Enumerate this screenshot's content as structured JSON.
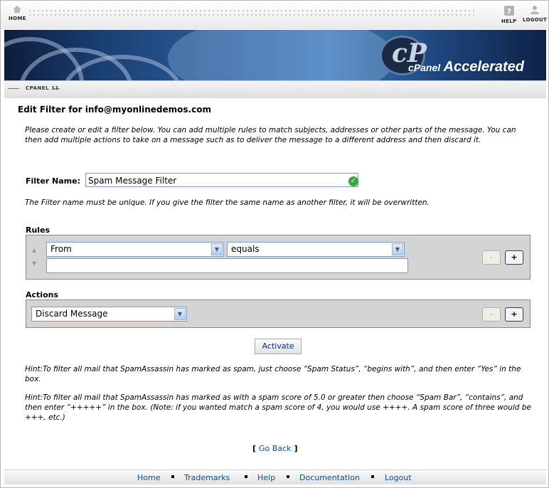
{
  "topbar": {
    "home_label": "HOME",
    "help_label": "HELP",
    "logout_label": "LOGOUT"
  },
  "banner": {
    "logo_cp": "cP",
    "logo_brand": "cPanel",
    "logo_suffix": "Accelerated"
  },
  "subbar": {
    "label": "CPANEL 11"
  },
  "page": {
    "title": "Edit Filter for info@myonlinedemos.com",
    "intro": "Please create or edit a filter below. You can add multiple rules to match subjects, addresses or other parts of the message. You can then add multiple actions to take on a message such as to deliver the message to a different address and then discard it.",
    "filter_name_label": "Filter Name:",
    "filter_name_value": "Spam Message Filter",
    "unique_note": "The Filter name must be unique. If you give the filter the same name as another filter, it will be overwritten."
  },
  "rules": {
    "label": "Rules",
    "part_value": "From",
    "match_value": "equals",
    "text_value": "",
    "minus_label": "-",
    "plus_label": "+"
  },
  "actions": {
    "label": "Actions",
    "action_value": "Discard Message",
    "minus_label": "-",
    "plus_label": "+"
  },
  "activate_label": "Activate",
  "hints": {
    "hint1": "Hint:To filter all mail that SpamAssassin has marked as spam, just choose “Spam Status”, “begins with”, and then enter “Yes” in the box.",
    "hint2": "Hint:To filter all mail that SpamAssassin has marked as with a spam score of 5.0 or greater then choose “Spam Bar”, “contains”, and then enter “+++++” in the box. (Note: if you wanted match a spam score of 4, you would use ++++. A spam score of three would be +++, etc.)"
  },
  "goback": {
    "open": "[",
    "label": "Go Back",
    "close": "]"
  },
  "footer": {
    "home": "Home",
    "trademarks": "Trademarks",
    "help": "Help",
    "documentation": "Documentation",
    "logout": "Logout"
  }
}
